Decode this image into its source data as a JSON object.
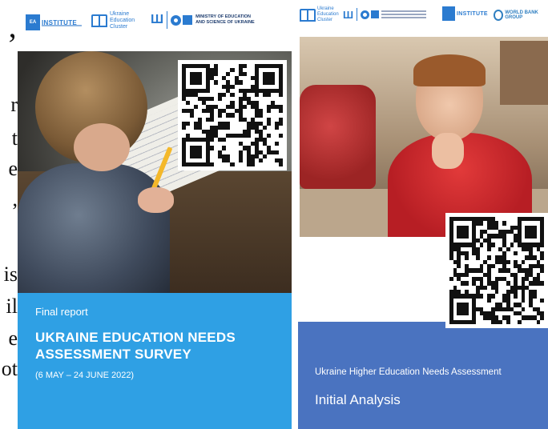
{
  "left_text_fragments": [
    "’",
    "r",
    "t",
    "e",
    ",",
    "is",
    "il",
    "e",
    "ot"
  ],
  "cover_left": {
    "logos": {
      "institute_text": "INSTITUTE",
      "institute_abbr": "EA",
      "cluster_text": "Ukraine Education Cluster",
      "ministry_text": "MINISTRY OF EDUCATION AND SCIENCE OF UKRAINE"
    },
    "report_label": "Final report",
    "title": "UKRAINE EDUCATION NEEDS ASSESSMENT SURVEY",
    "dates": "(6 MAY – 24 JUNE 2022)",
    "colors": {
      "band": "#2fa0e4",
      "logo": "#2b7bd0"
    }
  },
  "cover_right": {
    "logos": {
      "cluster_text": "Ukraine Education Cluster",
      "institute_text": "INSTITUTE",
      "worldbank_text": "WORLD BANK GROUP"
    },
    "subtitle": "Ukraine Higher Education Needs Assessment",
    "title": "Initial Analysis",
    "colors": {
      "band": "#4a73c0"
    }
  }
}
